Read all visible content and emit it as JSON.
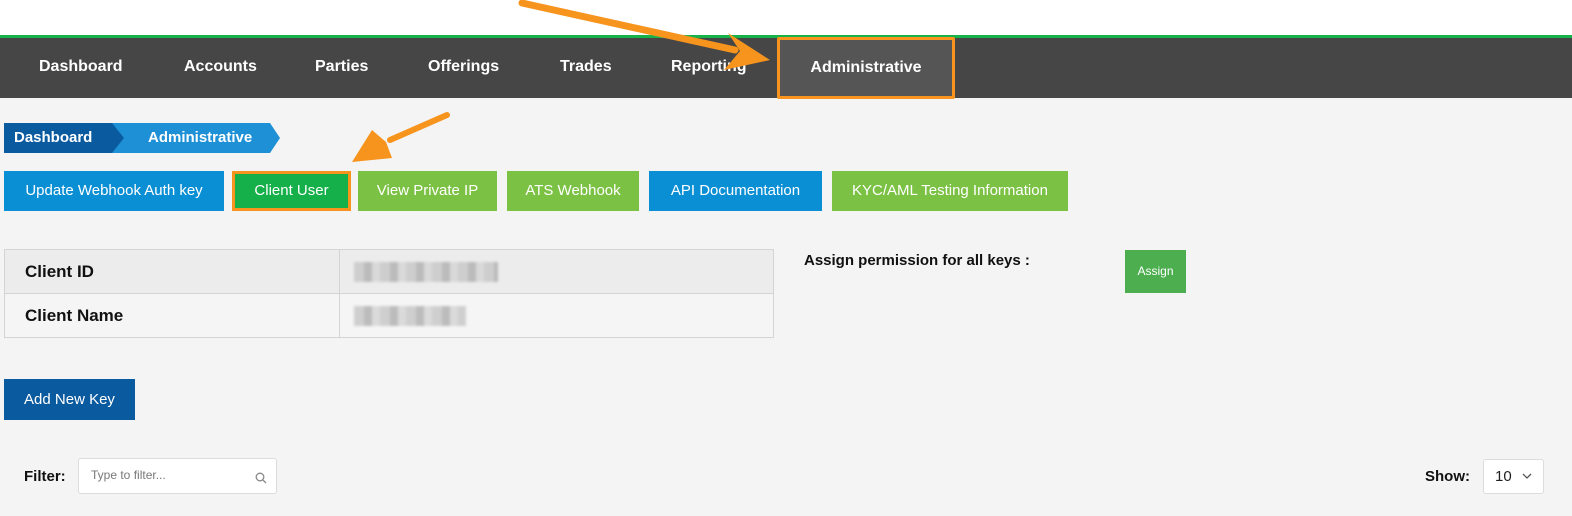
{
  "nav": {
    "items": [
      {
        "label": "Dashboard"
      },
      {
        "label": "Accounts"
      },
      {
        "label": "Parties"
      },
      {
        "label": "Offerings"
      },
      {
        "label": "Trades"
      },
      {
        "label": "Reporting"
      },
      {
        "label": "Administrative",
        "active": true
      }
    ]
  },
  "breadcrumb": {
    "items": [
      {
        "label": "Dashboard"
      },
      {
        "label": "Administrative"
      }
    ]
  },
  "actions": {
    "buttons": [
      {
        "label": "Update Webhook Auth key",
        "color": "#0b8fd4"
      },
      {
        "label": "Client User",
        "color": "#15b04a",
        "highlighted": true
      },
      {
        "label": "View Private IP",
        "color": "#7bc143"
      },
      {
        "label": "ATS Webhook",
        "color": "#7bc143"
      },
      {
        "label": "API Documentation",
        "color": "#0b8fd4"
      },
      {
        "label": "KYC/AML Testing Information",
        "color": "#7bc143"
      }
    ]
  },
  "client_info": {
    "rows": [
      {
        "label": "Client ID",
        "value": "[redacted]"
      },
      {
        "label": "Client Name",
        "value": "[redacted]"
      }
    ]
  },
  "permissions": {
    "label": "Assign permission for all keys :",
    "assign_button": "Assign"
  },
  "keys": {
    "add_button": "Add New Key",
    "filter_label": "Filter:",
    "filter_placeholder": "Type to filter...",
    "filter_value": "",
    "show_label": "Show:",
    "show_value": "10"
  },
  "colors": {
    "nav_bg": "#464646",
    "accent_green": "#17b24a",
    "highlight_orange": "#f7941d",
    "primary_blue": "#0a5aa0"
  }
}
